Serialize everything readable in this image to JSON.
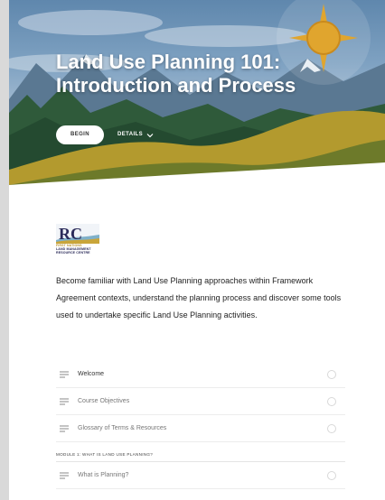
{
  "course": {
    "title_line1": "Land Use Planning 101:",
    "title_line2": "Introduction and Process",
    "begin_label": "BEGIN",
    "details_label": "DETAILS"
  },
  "org": {
    "logo_letters": "RC",
    "name_line1": "FIRST NATIONS",
    "name_line2": "LAND MANAGEMENT",
    "name_line3": "RESOURCE CENTRE"
  },
  "description": "Become familiar with Land Use Planning approaches within Framework Agreement contexts, understand the planning process and discover some tools used to undertake specific Land Use Planning activities.",
  "lessons": [
    {
      "label": "Welcome"
    },
    {
      "label": "Course Objectives"
    },
    {
      "label": "Glossary of Terms & Resources"
    }
  ],
  "module1": {
    "title": "MODULE 1: WHAT IS LAND USE PLANNING?",
    "lessons": [
      {
        "label": "What is Planning?"
      }
    ]
  },
  "colors": {
    "sun": "#e0a52e",
    "hill_gold": "#b39a2e",
    "hill_olive": "#6d7a2a"
  }
}
